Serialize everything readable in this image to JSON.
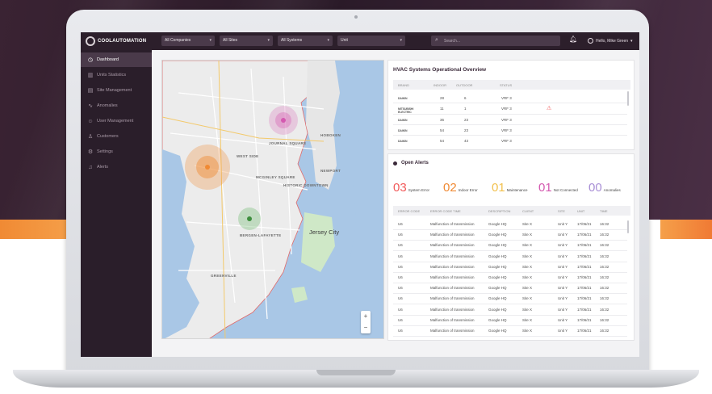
{
  "colors": {
    "system_error": "#f25a5a",
    "indoor_error": "#f08a34",
    "maintenance": "#f2c14e",
    "not_connected": "#d45ab0",
    "anomalies": "#a98fd6",
    "sidebar": "#2a1e2a",
    "topbar": "#2c1f2b"
  },
  "brand": {
    "logo_text": "COOLAUTOMATION"
  },
  "topbar": {
    "filters": [
      {
        "label": "All Companies",
        "icon": "chevron-down-icon"
      },
      {
        "label": "All Sites",
        "icon": "chevron-down-icon"
      },
      {
        "label": "All Systems",
        "icon": "chevron-down-icon"
      },
      {
        "label": "Unit",
        "icon": "chevron-down-icon"
      }
    ],
    "search_placeholder": "Search...",
    "user_name": "Hello, Mike Green"
  },
  "sidebar": {
    "items": [
      {
        "label": "Dashboard",
        "icon": "dashboard-icon",
        "active": true
      },
      {
        "label": "Units Statistics",
        "icon": "chart-icon"
      },
      {
        "label": "Site Management",
        "icon": "building-icon"
      },
      {
        "label": "Anomalies",
        "icon": "pulse-icon"
      },
      {
        "label": "User Management",
        "icon": "user-icon"
      },
      {
        "label": "Customers",
        "icon": "people-icon"
      },
      {
        "label": "Settings",
        "icon": "gear-icon"
      },
      {
        "label": "Alerts",
        "icon": "bell-icon"
      }
    ]
  },
  "map": {
    "city_label": "Jersey City",
    "area_labels": [
      "WEST SIDE",
      "JOURNAL SQUARE",
      "MCGINLEY SQUARE",
      "HISTORIC DOWNTOWN",
      "BERGEN-LAFAYETTE",
      "GREENVILLE",
      "HOBOKEN",
      "NEWPORT"
    ],
    "zoom_in": "+",
    "zoom_out": "−"
  },
  "overview": {
    "title": "HVAC Systems Operational Overview",
    "columns": [
      "BRAND",
      "INDOOR",
      "OUTDOOR",
      "STATUS"
    ],
    "rows": [
      {
        "brand": "DAIKIN",
        "indoor": "28",
        "outdoor": "6",
        "status": "VRF 3"
      },
      {
        "brand": "MITSUBISHI ELECTRIC",
        "indoor": "11",
        "outdoor": "1",
        "status": "VRF 3"
      },
      {
        "brand": "DAIKIN",
        "indoor": "36",
        "outdoor": "23",
        "status": "VRF 3"
      },
      {
        "brand": "DAIKIN",
        "indoor": "54",
        "outdoor": "23",
        "status": "VRF 3"
      },
      {
        "brand": "DAIKIN",
        "indoor": "54",
        "outdoor": "43",
        "status": "VRF 3"
      }
    ]
  },
  "alerts": {
    "title": "Open Alerts",
    "counters": [
      {
        "value": "03",
        "label": "System Error",
        "color_key": "system_error"
      },
      {
        "value": "02",
        "label": "Indoor Error",
        "color_key": "indoor_error"
      },
      {
        "value": "01",
        "label": "Maintenance",
        "color_key": "maintenance"
      },
      {
        "value": "01",
        "label": "Not Connected",
        "color_key": "not_connected"
      },
      {
        "value": "00",
        "label": "Anomalies",
        "color_key": "anomalies"
      }
    ],
    "columns": [
      "ERROR CODE",
      "ERROR CODE TIME",
      "DESCRIPTION",
      "CLIENT",
      "SITE",
      "UNIT",
      "TIME"
    ],
    "rows": [
      {
        "code": "U6",
        "desc": "Malfunction of transmission",
        "client": "Google HQ",
        "site": "Site X",
        "unit": "Unit Y",
        "date": "17/06/21",
        "time": "16:32"
      },
      {
        "code": "U6",
        "desc": "Malfunction of transmission",
        "client": "Google HQ",
        "site": "Site X",
        "unit": "Unit Y",
        "date": "17/06/21",
        "time": "16:32"
      },
      {
        "code": "U6",
        "desc": "Malfunction of transmission",
        "client": "Google HQ",
        "site": "Site X",
        "unit": "Unit Y",
        "date": "17/06/21",
        "time": "16:32"
      },
      {
        "code": "U6",
        "desc": "Malfunction of transmission",
        "client": "Google HQ",
        "site": "Site X",
        "unit": "Unit Y",
        "date": "17/06/21",
        "time": "16:32"
      },
      {
        "code": "U6",
        "desc": "Malfunction of transmission",
        "client": "Google HQ",
        "site": "Site X",
        "unit": "Unit Y",
        "date": "17/06/21",
        "time": "16:32"
      },
      {
        "code": "U6",
        "desc": "Malfunction of transmission",
        "client": "Google HQ",
        "site": "Site X",
        "unit": "Unit Y",
        "date": "17/06/21",
        "time": "16:32"
      },
      {
        "code": "U6",
        "desc": "Malfunction of transmission",
        "client": "Google HQ",
        "site": "Site X",
        "unit": "Unit Y",
        "date": "17/06/21",
        "time": "16:32"
      },
      {
        "code": "U6",
        "desc": "Malfunction of transmission",
        "client": "Google HQ",
        "site": "Site X",
        "unit": "Unit Y",
        "date": "17/06/21",
        "time": "16:32"
      },
      {
        "code": "U6",
        "desc": "Malfunction of transmission",
        "client": "Google HQ",
        "site": "Site X",
        "unit": "Unit Y",
        "date": "17/06/21",
        "time": "16:32"
      },
      {
        "code": "U6",
        "desc": "Malfunction of transmission",
        "client": "Google HQ",
        "site": "Site X",
        "unit": "Unit Y",
        "date": "17/06/21",
        "time": "16:32"
      },
      {
        "code": "U6",
        "desc": "Malfunction of transmission",
        "client": "Google HQ",
        "site": "Site X",
        "unit": "Unit Y",
        "date": "17/06/21",
        "time": "16:32"
      }
    ]
  }
}
